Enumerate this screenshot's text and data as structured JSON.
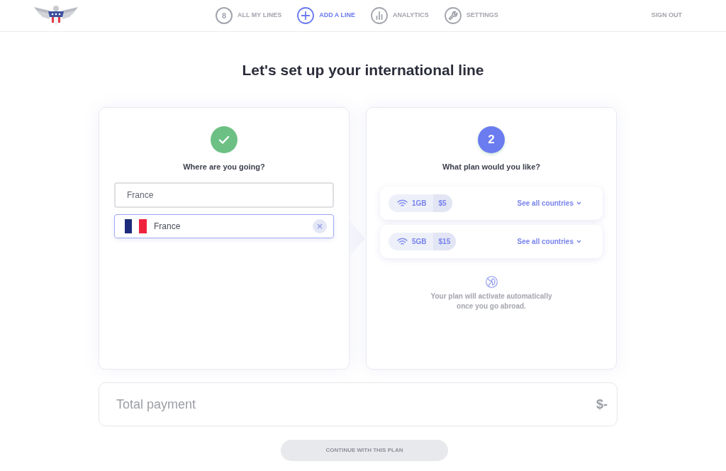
{
  "header": {
    "nav": [
      {
        "kind": "count",
        "count": "8",
        "label": "ALL MY LINES",
        "selected": false
      },
      {
        "kind": "add",
        "label": "ADD A LINE",
        "selected": true
      },
      {
        "kind": "analytics",
        "label": "ANALYTICS",
        "selected": false
      },
      {
        "kind": "settings",
        "label": "SETTINGS",
        "selected": false
      }
    ],
    "sign_out": "SIGN OUT"
  },
  "title": "Let's set up your international line",
  "steps": [
    {
      "kind": "done",
      "question": "Where are you going?",
      "search": {
        "value": "France"
      },
      "selection": {
        "name": "France"
      }
    },
    {
      "kind": "number",
      "number": "2",
      "question": "What plan would you like?",
      "plans": [
        {
          "data": "1GB",
          "price": "$5",
          "link": "See all countries"
        },
        {
          "data": "5GB",
          "price": "$15",
          "link": "See all countries"
        }
      ],
      "note": "Your plan will activate automatically once you go abroad."
    }
  ],
  "total": {
    "label": "Total payment",
    "amount": "$-"
  },
  "continue_button": {
    "label": "CONTINUE WITH THIS PLAN",
    "disabled": true
  }
}
